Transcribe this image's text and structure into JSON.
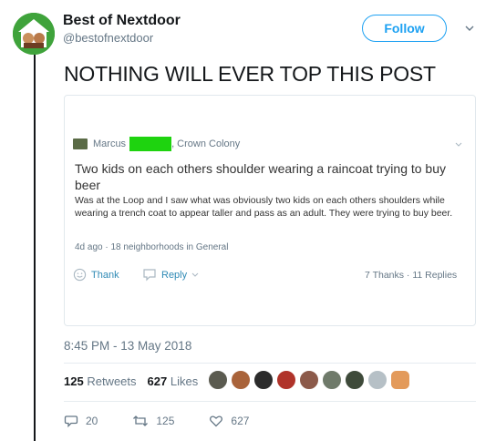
{
  "tweet": {
    "display_name": "Best of Nextdoor",
    "handle": "@bestofnextdoor",
    "follow_label": "Follow",
    "text": "NOTHING WILL EVER TOP THIS POST",
    "timestamp": "8:45 PM - 13 May 2018",
    "retweets_count": "125",
    "retweets_label": "Retweets",
    "likes_count": "627",
    "likes_label": "Likes",
    "reply_count": "20",
    "retweet_count": "125",
    "like_count": "627",
    "icons": [
      "chevron-down-icon",
      "reply-icon",
      "retweet-icon",
      "heart-icon"
    ]
  },
  "embedded_post": {
    "author_first": "Marcus",
    "author_location": ", Crown Colony",
    "title": "Two kids on each others shoulder wearing a raincoat trying to buy beer",
    "body": "Was at the Loop and I saw what was obviously two kids on each others shoulders while wearing a trench coat to appear taller and pass as an adult. They were trying to buy beer.",
    "meta": "4d ago · 18 neighborhoods in General",
    "thank_label": "Thank",
    "reply_label": "Reply",
    "stats": "7 Thanks · 11 Replies",
    "icons": [
      "smile-icon",
      "speech-bubble-icon",
      "chevron-down-icon"
    ]
  },
  "colors": {
    "accent": "#1da1f2",
    "redaction": "#1ed30f",
    "nextdoor_link": "#2f8ab5",
    "muted": "#657786"
  }
}
